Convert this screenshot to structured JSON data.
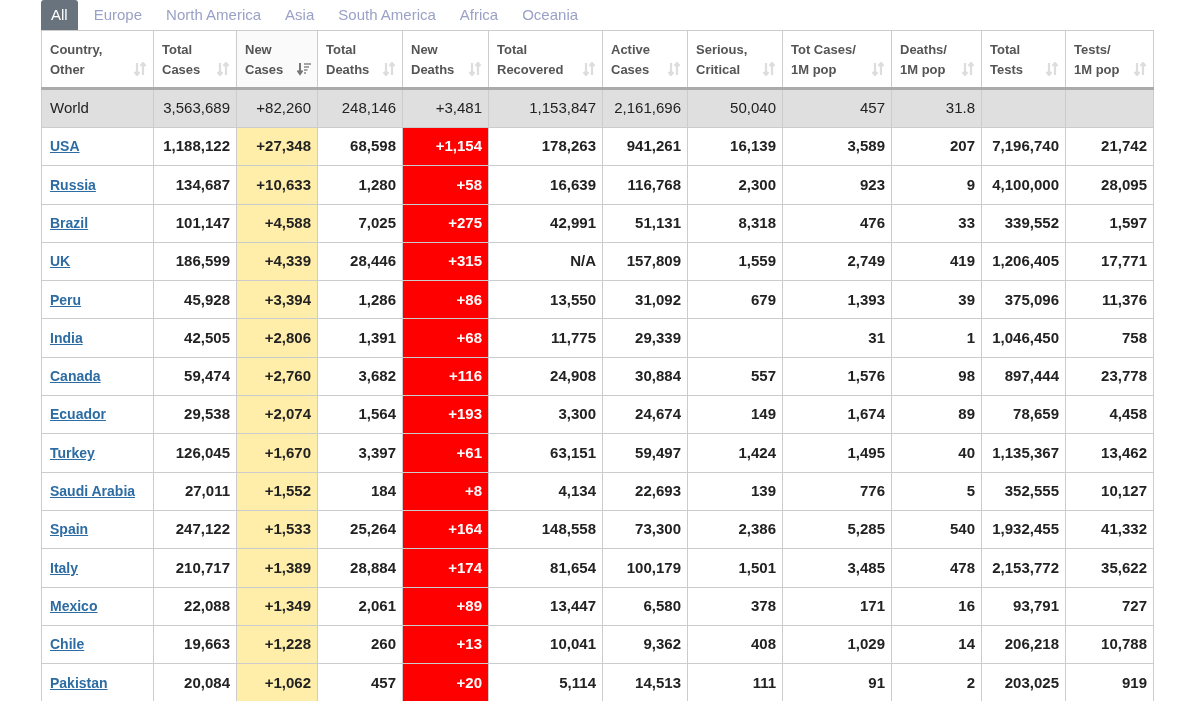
{
  "tabs": [
    {
      "label": "All",
      "selected": true
    },
    {
      "label": "Europe",
      "selected": false
    },
    {
      "label": "North America",
      "selected": false
    },
    {
      "label": "Asia",
      "selected": false
    },
    {
      "label": "South America",
      "selected": false
    },
    {
      "label": "Africa",
      "selected": false
    },
    {
      "label": "Oceania",
      "selected": false
    }
  ],
  "table": {
    "columns": [
      {
        "label": "Country,",
        "label2": "Other",
        "kind": "country",
        "sorted": false
      },
      {
        "label": "Total",
        "label2": "Cases",
        "kind": "number",
        "sorted": false
      },
      {
        "label": "New",
        "label2": "Cases",
        "kind": "new_cases",
        "sorted": true
      },
      {
        "label": "Total",
        "label2": "Deaths",
        "kind": "number",
        "sorted": false
      },
      {
        "label": "New",
        "label2": "Deaths",
        "kind": "new_deaths",
        "sorted": false
      },
      {
        "label": "Total",
        "label2": "Recovered",
        "kind": "number",
        "sorted": false
      },
      {
        "label": "Active",
        "label2": "Cases",
        "kind": "number",
        "sorted": false
      },
      {
        "label": "Serious,",
        "label2": "Critical",
        "kind": "number",
        "sorted": false
      },
      {
        "label": "Tot Cases/",
        "label2": "1M pop",
        "kind": "number",
        "sorted": false
      },
      {
        "label": "Deaths/",
        "label2": "1M pop",
        "kind": "number",
        "sorted": false
      },
      {
        "label": "Total",
        "label2": "Tests",
        "kind": "number",
        "sorted": false
      },
      {
        "label": "Tests/",
        "label2": "1M pop",
        "kind": "number",
        "sorted": false
      }
    ],
    "rows": [
      {
        "kind": "world",
        "cells": [
          "World",
          "3,563,689",
          "+82,260",
          "248,146",
          "+3,481",
          "1,153,847",
          "2,161,696",
          "50,040",
          "457",
          "31.8",
          null,
          null
        ]
      },
      {
        "kind": "country",
        "cells": [
          "USA",
          "1,188,122",
          "+27,348",
          "68,598",
          "+1,154",
          "178,263",
          "941,261",
          "16,139",
          "3,589",
          "207",
          "7,196,740",
          "21,742"
        ]
      },
      {
        "kind": "country",
        "cells": [
          "Russia",
          "134,687",
          "+10,633",
          "1,280",
          "+58",
          "16,639",
          "116,768",
          "2,300",
          "923",
          "9",
          "4,100,000",
          "28,095"
        ]
      },
      {
        "kind": "country",
        "cells": [
          "Brazil",
          "101,147",
          "+4,588",
          "7,025",
          "+275",
          "42,991",
          "51,131",
          "8,318",
          "476",
          "33",
          "339,552",
          "1,597"
        ]
      },
      {
        "kind": "country",
        "cells": [
          "UK",
          "186,599",
          "+4,339",
          "28,446",
          "+315",
          "N/A",
          "157,809",
          "1,559",
          "2,749",
          "419",
          "1,206,405",
          "17,771"
        ]
      },
      {
        "kind": "country",
        "cells": [
          "Peru",
          "45,928",
          "+3,394",
          "1,286",
          "+86",
          "13,550",
          "31,092",
          "679",
          "1,393",
          "39",
          "375,096",
          "11,376"
        ]
      },
      {
        "kind": "country",
        "cells": [
          "India",
          "42,505",
          "+2,806",
          "1,391",
          "+68",
          "11,775",
          "29,339",
          null,
          "31",
          "1",
          "1,046,450",
          "758"
        ]
      },
      {
        "kind": "country",
        "cells": [
          "Canada",
          "59,474",
          "+2,760",
          "3,682",
          "+116",
          "24,908",
          "30,884",
          "557",
          "1,576",
          "98",
          "897,444",
          "23,778"
        ]
      },
      {
        "kind": "country",
        "cells": [
          "Ecuador",
          "29,538",
          "+2,074",
          "1,564",
          "+193",
          "3,300",
          "24,674",
          "149",
          "1,674",
          "89",
          "78,659",
          "4,458"
        ]
      },
      {
        "kind": "country",
        "cells": [
          "Turkey",
          "126,045",
          "+1,670",
          "3,397",
          "+61",
          "63,151",
          "59,497",
          "1,424",
          "1,495",
          "40",
          "1,135,367",
          "13,462"
        ]
      },
      {
        "kind": "country",
        "cells": [
          "Saudi Arabia",
          "27,011",
          "+1,552",
          "184",
          "+8",
          "4,134",
          "22,693",
          "139",
          "776",
          "5",
          "352,555",
          "10,127"
        ]
      },
      {
        "kind": "country",
        "cells": [
          "Spain",
          "247,122",
          "+1,533",
          "25,264",
          "+164",
          "148,558",
          "73,300",
          "2,386",
          "5,285",
          "540",
          "1,932,455",
          "41,332"
        ]
      },
      {
        "kind": "country",
        "cells": [
          "Italy",
          "210,717",
          "+1,389",
          "28,884",
          "+174",
          "81,654",
          "100,179",
          "1,501",
          "3,485",
          "478",
          "2,153,772",
          "35,622"
        ]
      },
      {
        "kind": "country",
        "cells": [
          "Mexico",
          "22,088",
          "+1,349",
          "2,061",
          "+89",
          "13,447",
          "6,580",
          "378",
          "171",
          "16",
          "93,791",
          "727"
        ]
      },
      {
        "kind": "country",
        "cells": [
          "Chile",
          "19,663",
          "+1,228",
          "260",
          "+13",
          "10,041",
          "9,362",
          "408",
          "1,029",
          "14",
          "206,218",
          "10,788"
        ]
      },
      {
        "kind": "country",
        "cells": [
          "Pakistan",
          "20,084",
          "+1,062",
          "457",
          "+20",
          "5,114",
          "14,513",
          "111",
          "91",
          "2",
          "203,025",
          "919"
        ]
      }
    ]
  }
}
